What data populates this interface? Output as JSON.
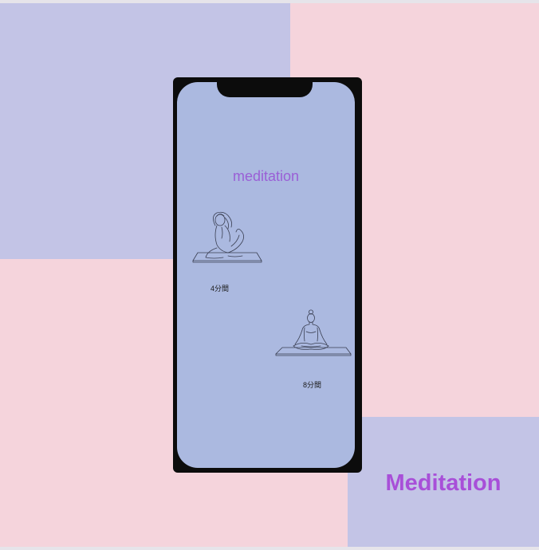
{
  "screen": {
    "title": "meditation",
    "sessions": [
      {
        "duration": "4分間",
        "icon": "yoga-pigeon-pose-icon"
      },
      {
        "duration": "8分間",
        "icon": "yoga-lotus-pose-icon"
      }
    ]
  },
  "brand": {
    "name": "Meditation"
  },
  "colors": {
    "background_purple": "#c3c4e6",
    "background_pink": "#f5d4dc",
    "screen_background": "#abb9e0",
    "accent_purple": "#a84fd8",
    "phone_frame": "#0c0c0c"
  }
}
